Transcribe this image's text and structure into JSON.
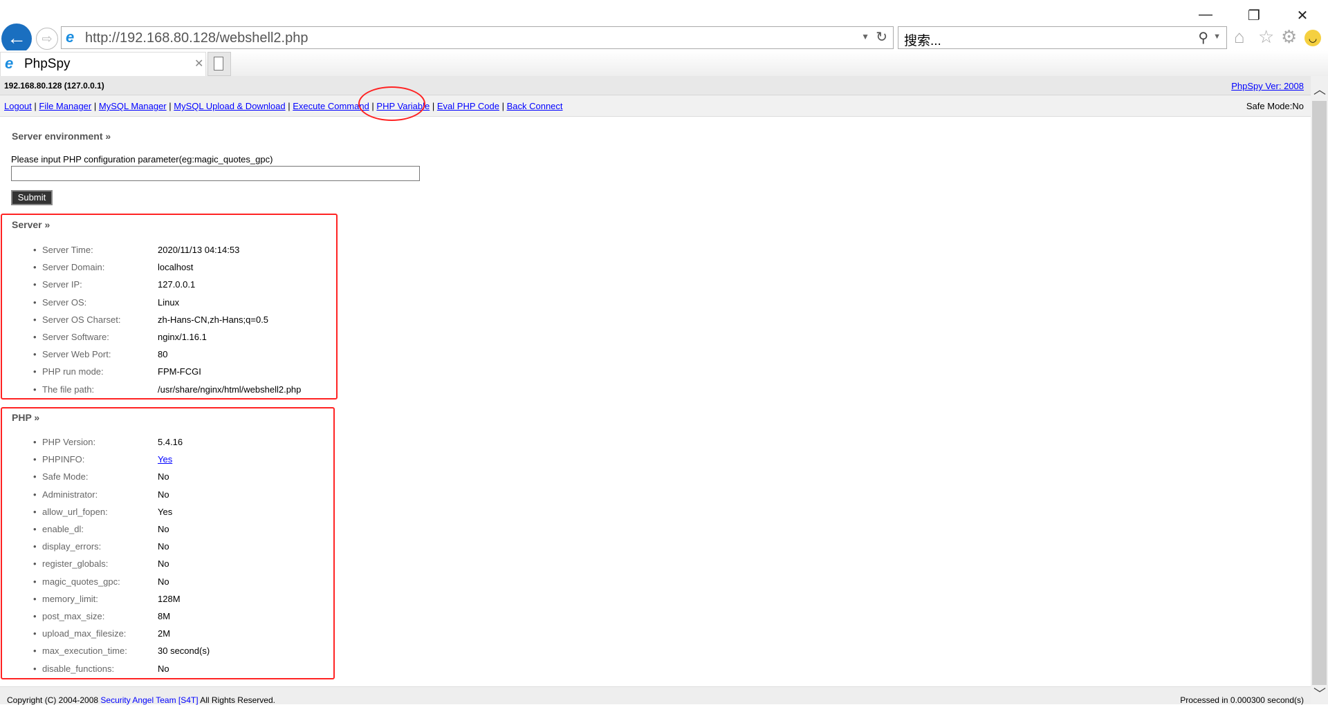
{
  "browser": {
    "url": "http://192.168.80.128/webshell2.php",
    "search_placeholder": "搜索...",
    "tab_title": "PhpSpy",
    "window_controls": {
      "minimize": "—",
      "restore": "❐",
      "close": "✕"
    }
  },
  "header": {
    "host": "192.168.80.128 (127.0.0.1)",
    "version_link": "PhpSpy Ver: 2008"
  },
  "nav": {
    "items": [
      "Logout",
      "File Manager",
      "MySQL Manager",
      "MySQL Upload & Download",
      "Execute Command",
      "PHP Variable",
      "Eval PHP Code",
      "Back Connect"
    ],
    "safe_mode": "Safe Mode:No",
    "highlight_color": "#ff0000"
  },
  "env": {
    "title": "Server environment »",
    "input_label": "Please input PHP configuration parameter(eg:magic_quotes_gpc)",
    "input_value": "",
    "submit": "Submit"
  },
  "server": {
    "title": "Server »",
    "rows": [
      {
        "label": "Server Time:",
        "value": "2020/11/13 04:14:53"
      },
      {
        "label": "Server Domain:",
        "value": "localhost"
      },
      {
        "label": "Server IP:",
        "value": "127.0.0.1"
      },
      {
        "label": "Server OS:",
        "value": "Linux"
      },
      {
        "label": "Server OS Charset:",
        "value": "zh-Hans-CN,zh-Hans;q=0.5"
      },
      {
        "label": "Server Software:",
        "value": "nginx/1.16.1"
      },
      {
        "label": "Server Web Port:",
        "value": "80"
      },
      {
        "label": "PHP run mode:",
        "value": "FPM-FCGI"
      },
      {
        "label": "The file path:",
        "value": "/usr/share/nginx/html/webshell2.php"
      }
    ]
  },
  "php": {
    "title": "PHP »",
    "rows": [
      {
        "label": "PHP Version:",
        "value": "5.4.16"
      },
      {
        "label": "PHPINFO:",
        "value": "Yes",
        "link": true
      },
      {
        "label": "Safe Mode:",
        "value": "No"
      },
      {
        "label": "Administrator:",
        "value": "No"
      },
      {
        "label": "allow_url_fopen:",
        "value": "Yes"
      },
      {
        "label": "enable_dl:",
        "value": "No"
      },
      {
        "label": "display_errors:",
        "value": "No"
      },
      {
        "label": "register_globals:",
        "value": "No"
      },
      {
        "label": "magic_quotes_gpc:",
        "value": "No"
      },
      {
        "label": "memory_limit:",
        "value": "128M"
      },
      {
        "label": "post_max_size:",
        "value": "8M"
      },
      {
        "label": "upload_max_filesize:",
        "value": "2M"
      },
      {
        "label": "max_execution_time:",
        "value": "30 second(s)"
      },
      {
        "label": "disable_functions:",
        "value": "No"
      }
    ]
  },
  "footer": {
    "copyright_pre": "Copyright (C) 2004-2008 ",
    "team_link": "Security Angel Team [S4T]",
    "copyright_post": " All Rights Reserved.",
    "processed": "Processed in 0.000300 second(s)"
  }
}
